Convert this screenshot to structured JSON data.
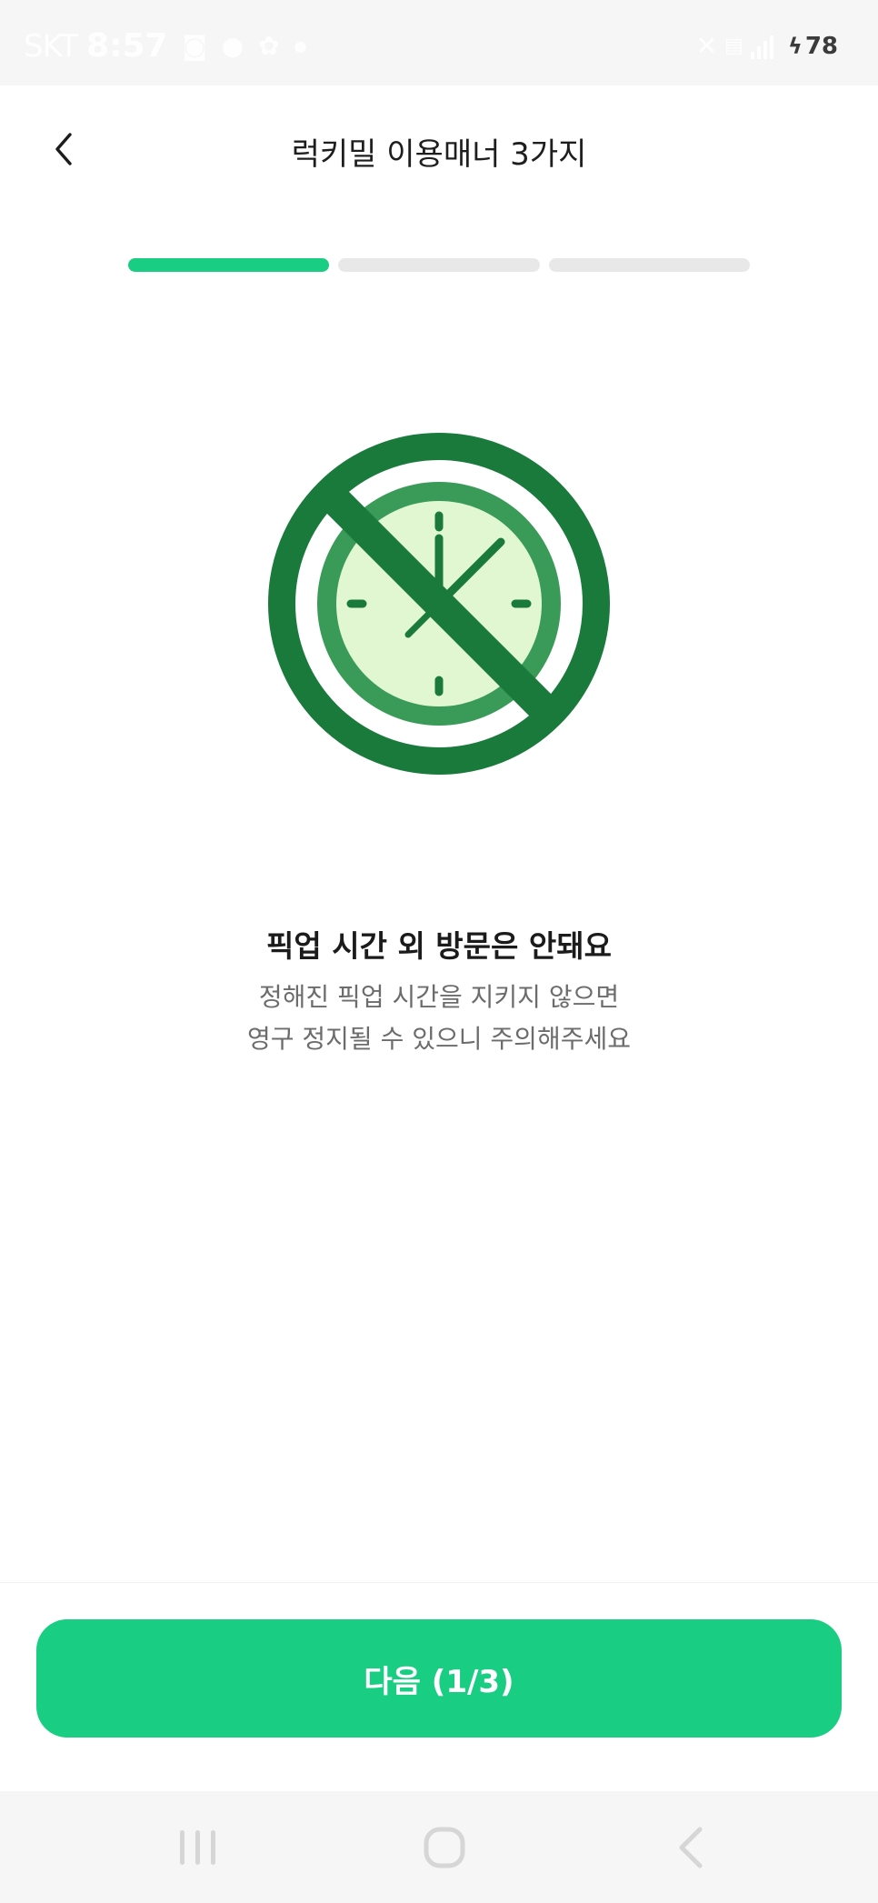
{
  "status_bar": {
    "carrier": "SKT",
    "time": "8:57",
    "notification_icons": [
      "camera-icon",
      "chat-bubble-icon",
      "cat-icon",
      "dot-icon"
    ],
    "battery_level": "78",
    "battery_charging": true
  },
  "header": {
    "title": "럭키밀 이용매너 3가지",
    "back_icon": "chevron-left-icon"
  },
  "progress": {
    "current_step": 1,
    "total_steps": 3
  },
  "hero": {
    "icon": "no-clock-icon"
  },
  "content": {
    "headline": "픽업 시간 외 방문은 안돼요",
    "description_lines": [
      "정해진 픽업 시간을 지키지 않으면",
      "영구 정지될 수 있으니 주의해주세요"
    ]
  },
  "footer": {
    "next_label": "다음 (1/3)"
  },
  "nav_bar": {
    "buttons": [
      "recent-apps-icon",
      "home-icon",
      "system-back-icon"
    ]
  },
  "colors": {
    "accent": "#19cd82",
    "progress_inactive": "#e8e8e8",
    "icon_dark_green": "#1a7a3c",
    "icon_mid_green": "#3a9a57",
    "icon_light_green": "#e0f7d1"
  }
}
